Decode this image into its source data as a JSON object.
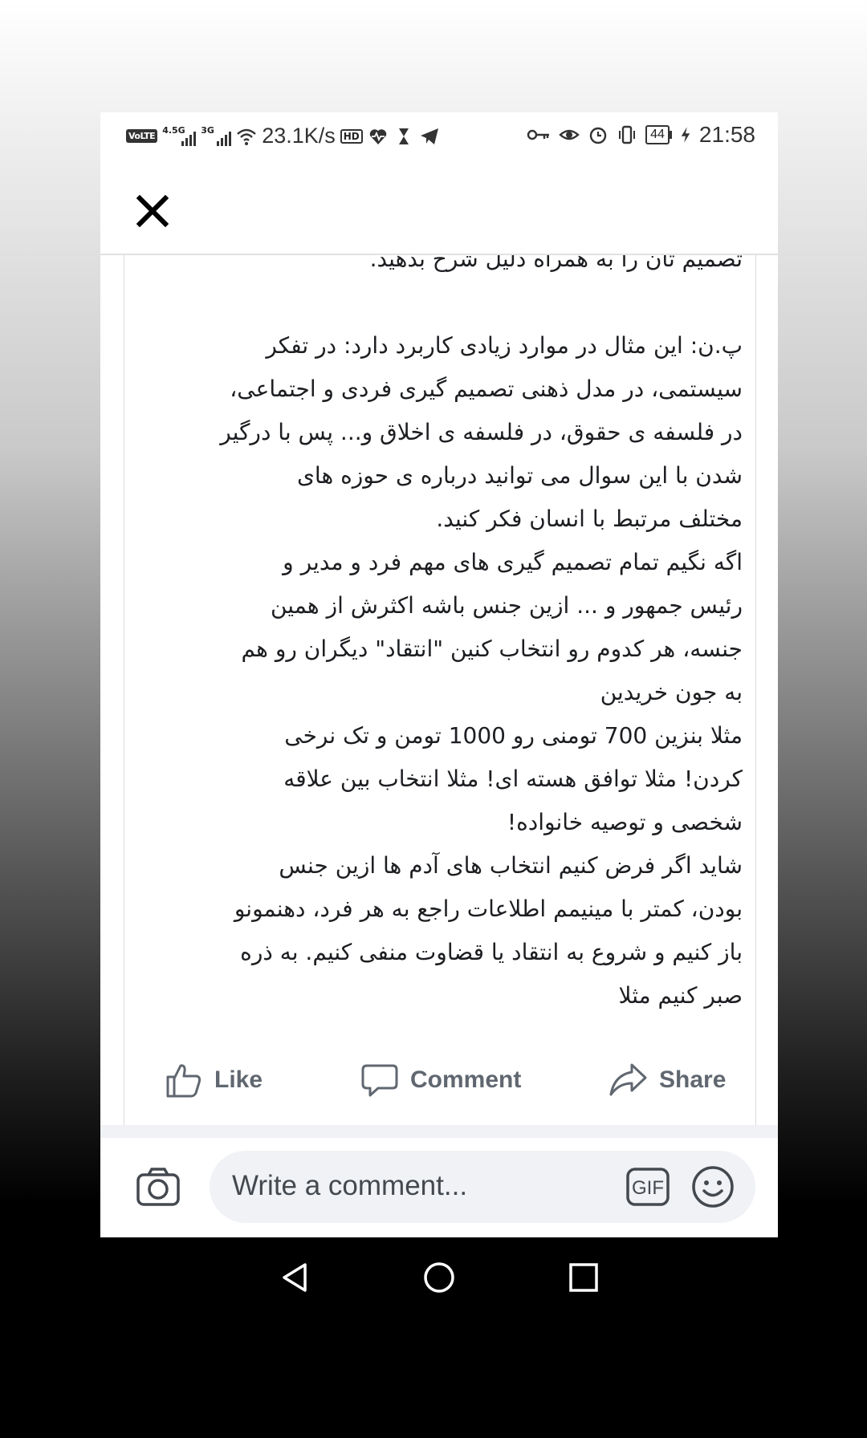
{
  "status_bar": {
    "volte": "VoLTE",
    "network_1": "4.5G",
    "network_2": "3G",
    "speed": "23.1K/s",
    "hd": "HD",
    "battery": "44",
    "time": "21:58"
  },
  "post": {
    "lines": [
      "تصمیم تان را به همراه دلیل شرح بدهید.",
      "",
      "پ.ن: این مثال در موارد زیادی کاربرد دارد: در تفکر",
      "سیستمی، در مدل ذهنی تصمیم گیری فردی و اجتماعی،",
      "در فلسفه ی حقوق، در فلسفه ی اخلاق و... پس با درگیر",
      "شدن با این سوال می توانید درباره ی حوزه های",
      "مختلف مرتبط با انسان فکر کنید.",
      "اگه نگیم تمام تصمیم گیری های مهم فرد و مدیر و",
      "رئیس جمهور و ... ازین جنس باشه اکثرش از همین",
      "جنسه، هر کدوم رو انتخاب کنین \"انتقاد\" دیگران رو هم",
      "به جون خریدین",
      "مثلا بنزین 700 تومنی رو 1000 تومن و تک نرخی",
      "کردن! مثلا توافق هسته ای! مثلا انتخاب بین علاقه",
      "شخصی و توصیه خانواده!",
      "شاید اگر فرض کنیم انتخاب های آدم ها ازین جنس",
      "بودن، کمتر با مینیمم اطلاعات راجع به هر فرد، دهنمونو",
      "باز کنیم و شروع به انتقاد یا قضاوت منفی کنیم. به ذره",
      "صبر کنیم مثلا"
    ]
  },
  "actions": {
    "like": "Like",
    "comment": "Comment",
    "share": "Share"
  },
  "comment_box": {
    "placeholder": "Write a comment...",
    "gif": "GIF"
  },
  "icons": {
    "close": "close-icon",
    "like": "thumbs-up-icon",
    "comment": "speech-bubble-icon",
    "share": "share-arrow-icon",
    "camera": "camera-icon",
    "emoji": "smiley-icon",
    "back": "back-triangle-icon",
    "home": "home-circle-icon",
    "recents": "recents-square-icon"
  },
  "colors": {
    "text": "#1c1e21",
    "action_text": "#606770",
    "input_bg": "#f0f2f5",
    "nav_bg": "#000000"
  }
}
